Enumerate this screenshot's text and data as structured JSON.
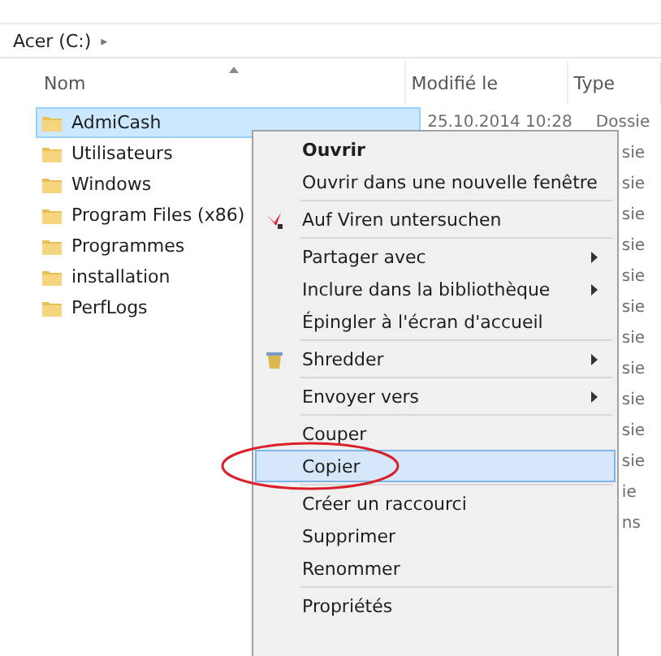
{
  "breadcrumb": {
    "location": "Acer (C:)",
    "arrow": "▸"
  },
  "table": {
    "columns": [
      "Nom",
      "Modifié le",
      "Type"
    ],
    "rows": [
      {
        "name": "AdmiCash",
        "modified": "25.10.2014 10:28",
        "selected": true
      },
      {
        "name": "Utilisateurs",
        "selected": false
      },
      {
        "name": "Windows",
        "selected": false
      },
      {
        "name": "Program Files (x86)",
        "selected": false
      },
      {
        "name": "Programmes",
        "selected": false
      },
      {
        "name": "installation",
        "selected": false
      },
      {
        "name": "PerfLogs",
        "selected": false
      }
    ],
    "type_column": [
      "Dossie",
      "sie",
      "sie",
      "sie",
      "sie",
      "sie",
      "sie",
      "sie",
      "sie",
      "sie",
      "sie",
      "sie",
      "ie",
      "ns"
    ]
  },
  "context_menu": {
    "items": [
      {
        "kind": "item",
        "label": "Ouvrir",
        "bold": true,
        "selected": false
      },
      {
        "kind": "item",
        "label": "Ouvrir dans une nouvelle fenêtre",
        "selected": false
      },
      {
        "kind": "separator"
      },
      {
        "kind": "scan",
        "label": "Auf Viren untersuchen",
        "selected": false
      },
      {
        "kind": "separator"
      },
      {
        "kind": "item",
        "label": "Partager avec",
        "submenu": true,
        "selected": false
      },
      {
        "kind": "item",
        "label": "Inclure dans la bibliothèque",
        "submenu": true,
        "selected": false
      },
      {
        "kind": "item",
        "label": "Épingler à l'écran d'accueil",
        "selected": false
      },
      {
        "kind": "separator"
      },
      {
        "kind": "shredder",
        "label": "Shredder",
        "submenu": true,
        "selected": false
      },
      {
        "kind": "separator"
      },
      {
        "kind": "item",
        "label": "Envoyer vers",
        "submenu": true,
        "selected": false
      },
      {
        "kind": "separator"
      },
      {
        "kind": "item",
        "label": "Couper",
        "selected": false
      },
      {
        "kind": "item",
        "label": "Copier",
        "selected": true,
        "circled": true
      },
      {
        "kind": "separator"
      },
      {
        "kind": "item",
        "label": "Créer un raccourci",
        "selected": false
      },
      {
        "kind": "item",
        "label": "Supprimer",
        "selected": false
      },
      {
        "kind": "item",
        "label": "Renommer",
        "selected": false
      },
      {
        "kind": "separator"
      },
      {
        "kind": "item",
        "label": "Propriétés",
        "selected": false
      }
    ]
  }
}
